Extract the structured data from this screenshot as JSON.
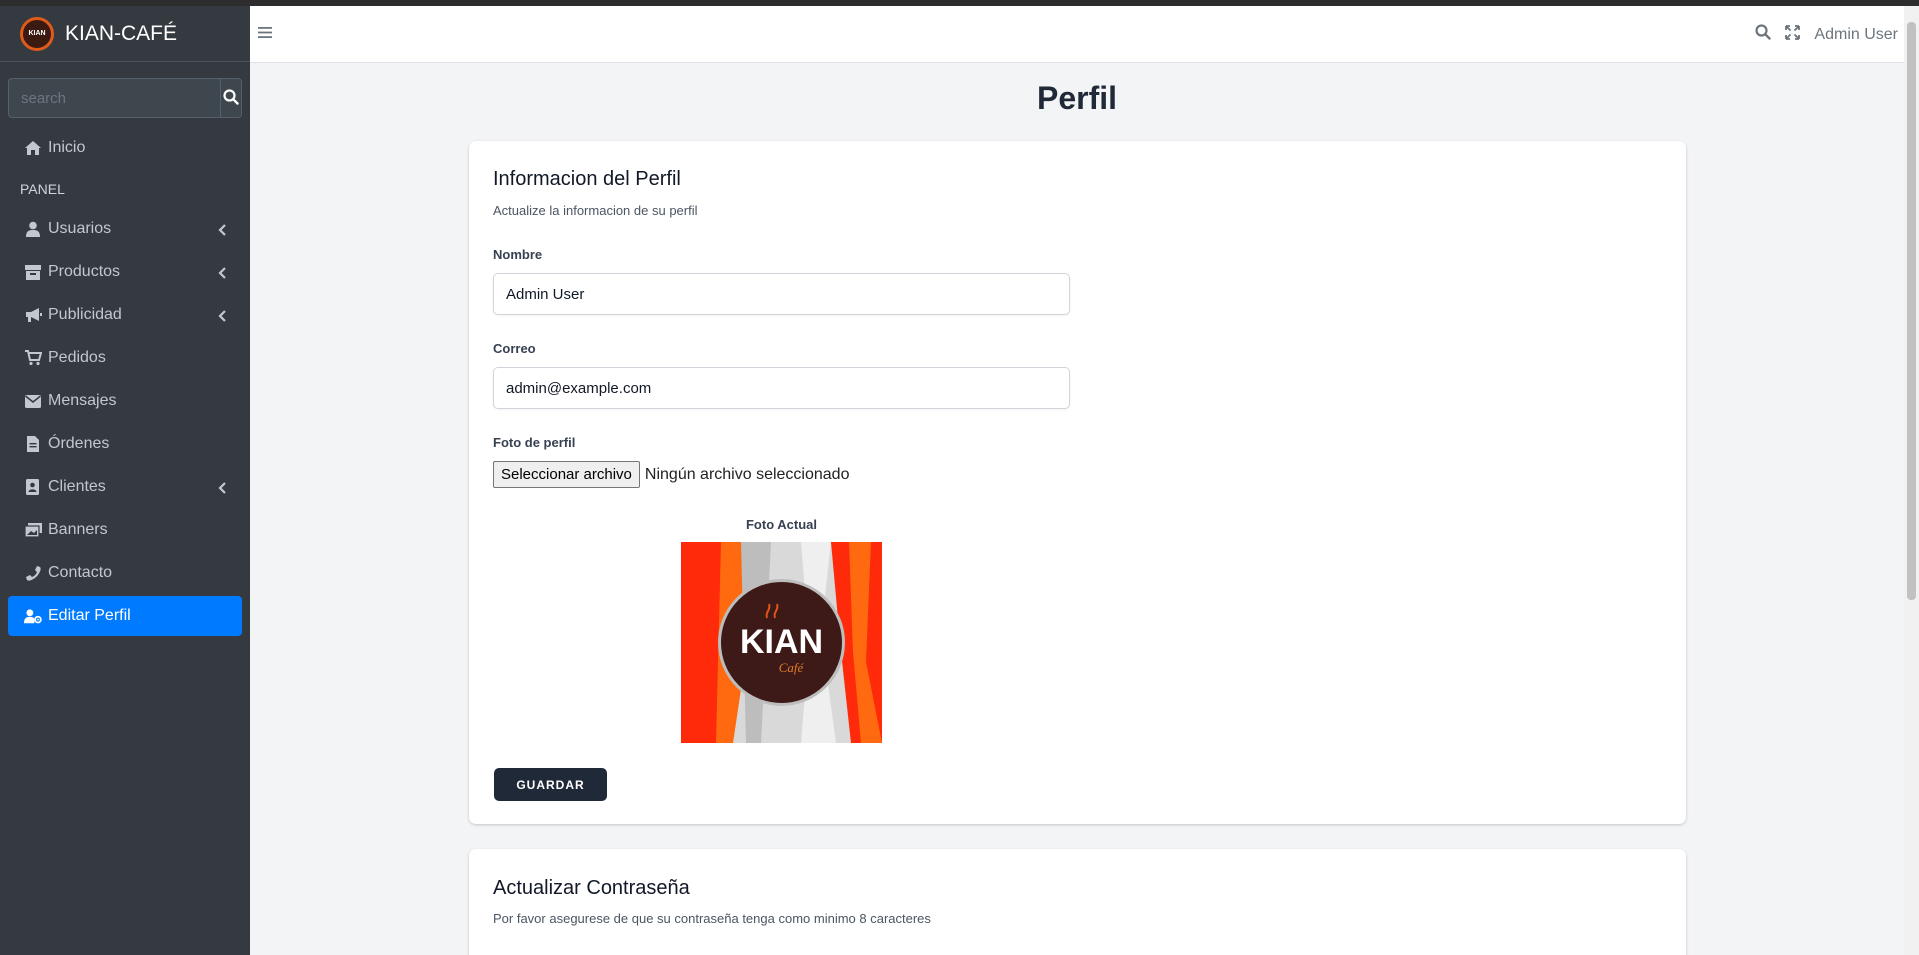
{
  "brand": {
    "name": "KIAN-CAFÉ",
    "logo_text": "KIAN"
  },
  "sidebar": {
    "search_placeholder": "search",
    "header": "PANEL",
    "items": [
      {
        "label": "Inicio",
        "icon": "home-icon",
        "has_children": false,
        "active": false
      },
      {
        "label": "Usuarios",
        "icon": "user-icon",
        "has_children": true,
        "active": false
      },
      {
        "label": "Productos",
        "icon": "box-icon",
        "has_children": true,
        "active": false
      },
      {
        "label": "Publicidad",
        "icon": "megaphone-icon",
        "has_children": true,
        "active": false
      },
      {
        "label": "Pedidos",
        "icon": "cart-icon",
        "has_children": false,
        "active": false
      },
      {
        "label": "Mensajes",
        "icon": "envelope-icon",
        "has_children": false,
        "active": false
      },
      {
        "label": "Órdenes",
        "icon": "file-icon",
        "has_children": false,
        "active": false
      },
      {
        "label": "Clientes",
        "icon": "address-book-icon",
        "has_children": true,
        "active": false
      },
      {
        "label": "Banners",
        "icon": "images-icon",
        "has_children": false,
        "active": false
      },
      {
        "label": "Contacto",
        "icon": "phone-icon",
        "has_children": false,
        "active": false
      },
      {
        "label": "Editar Perfil",
        "icon": "user-cog-icon",
        "has_children": false,
        "active": true
      }
    ]
  },
  "topbar": {
    "user_name": "Admin User"
  },
  "page": {
    "title": "Perfil"
  },
  "profile_card": {
    "title": "Informacion del Perfil",
    "subtitle": "Actualize la informacion de su perfil",
    "name_label": "Nombre",
    "name_value": "Admin User",
    "email_label": "Correo",
    "email_value": "admin@example.com",
    "photo_label": "Foto de perfil",
    "file_button": "Seleccionar archivo",
    "file_status": "Ningún archivo seleccionado",
    "current_photo_label": "Foto Actual",
    "photo_logo_main": "KIAN",
    "photo_logo_sub": "Café",
    "save_button": "GUARDAR"
  },
  "password_card": {
    "title": "Actualizar Contraseña",
    "subtitle": "Por favor asegurese de que su contraseña tenga como minimo 8 caracteres"
  },
  "colors": {
    "sidebar_bg": "#343a40",
    "active_item": "#007bff",
    "save_button": "#1f2937",
    "page_bg": "#f3f4f6"
  }
}
